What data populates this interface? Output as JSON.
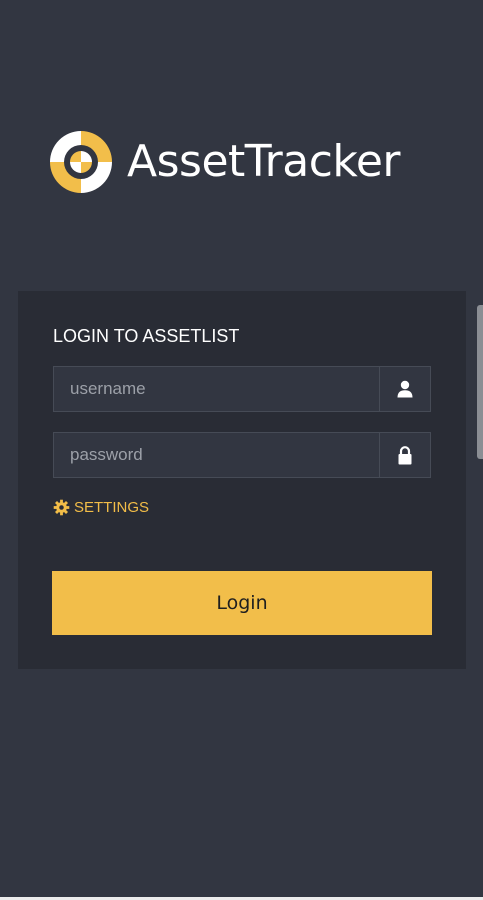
{
  "brand": {
    "name": "AssetTracker",
    "accent_color": "#f2be4a",
    "logo_icon": "target-crosshair-logo"
  },
  "login": {
    "title": "LOGIN TO ASSETLIST",
    "username": {
      "placeholder": "username",
      "value": "",
      "icon": "user-icon"
    },
    "password": {
      "placeholder": "password",
      "value": "",
      "icon": "lock-icon"
    },
    "settings_label": "SETTINGS",
    "settings_icon": "gear-icon",
    "submit_label": "Login"
  }
}
